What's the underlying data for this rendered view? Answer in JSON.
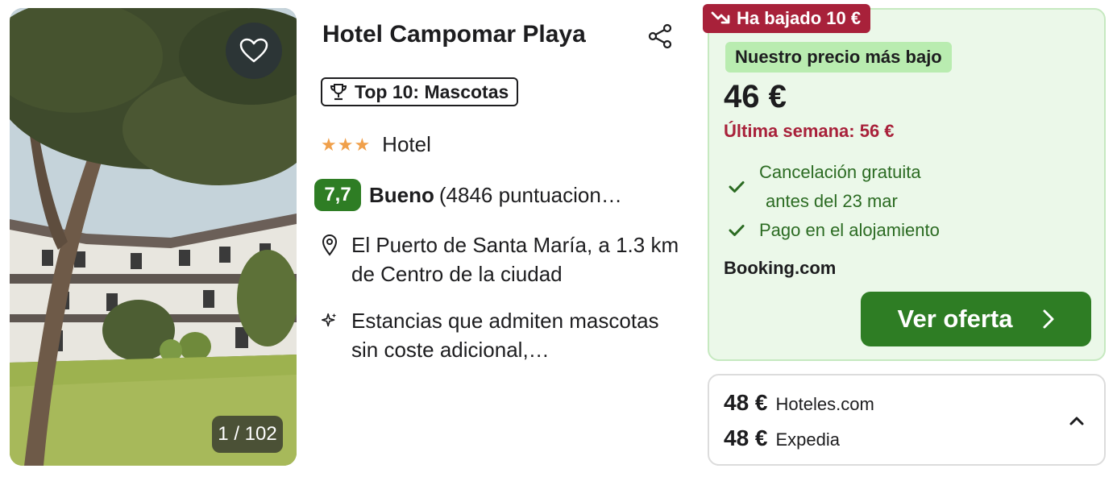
{
  "hotel": {
    "name": "Hotel Campomar Playa",
    "award_badge": "Top 10: Mascotas",
    "stars": "★★★",
    "type": "Hotel",
    "rating": {
      "score": "7,7",
      "label": "Bueno",
      "reviews": "(4846 puntuacion…"
    },
    "location": "El Puerto de Santa María, a 1.3 km de Centro de la ciudad",
    "highlight": "Estancias que admiten mascotas sin coste adicional,…"
  },
  "photo": {
    "counter": "1 / 102"
  },
  "deal": {
    "drop_badge": "Ha bajado 10 €",
    "lowest_label": "Nuestro precio más bajo",
    "price": "46 €",
    "last_week": "Última semana: 56 €",
    "cancellation_line1": "Cancelación gratuita",
    "cancellation_line2": "antes del 23 mar",
    "payment": "Pago en el alojamiento",
    "provider": "Booking.com",
    "cta_label": "Ver oferta"
  },
  "other_offers": [
    {
      "price": "48 €",
      "provider": "Hoteles.com"
    },
    {
      "price": "48 €",
      "provider": "Expedia"
    }
  ],
  "colors": {
    "primary_green": "#2e7d24",
    "deal_bg": "#ebf8e9",
    "drop_red": "#a8213a",
    "star_orange": "#f0a04b"
  },
  "icons": [
    "heart-icon",
    "share-icon",
    "trophy-icon",
    "location-pin-icon",
    "sparkle-icon",
    "check-icon",
    "chevron-right-icon",
    "chevron-up-icon",
    "trend-down-icon"
  ]
}
